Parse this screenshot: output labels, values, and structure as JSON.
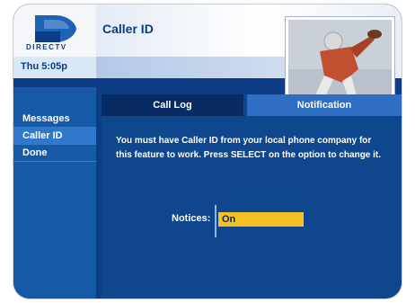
{
  "brand": {
    "logo_text": "DIRECTV"
  },
  "header": {
    "title": "Caller ID"
  },
  "status": {
    "time": "Thu 5:05p"
  },
  "menu": {
    "items": [
      {
        "label": "Messages"
      },
      {
        "label": "Caller ID",
        "active": true
      },
      {
        "label": "Done"
      }
    ]
  },
  "tabs": [
    {
      "label": "Call Log",
      "selected": false
    },
    {
      "label": "Notification",
      "selected": true
    }
  ],
  "content": {
    "description": "You must have Caller ID from your local phone company for this feature to work. Press SELECT on the option to change it.",
    "notices_label": "Notices:",
    "notices_value": "On"
  },
  "colors": {
    "accent": "#f6c124",
    "panel": "#0f478f",
    "sidebar": "#165aa7"
  },
  "icons": {
    "logo": "directv-logo-icon",
    "thumbnail": "football-player-thumbnail"
  }
}
